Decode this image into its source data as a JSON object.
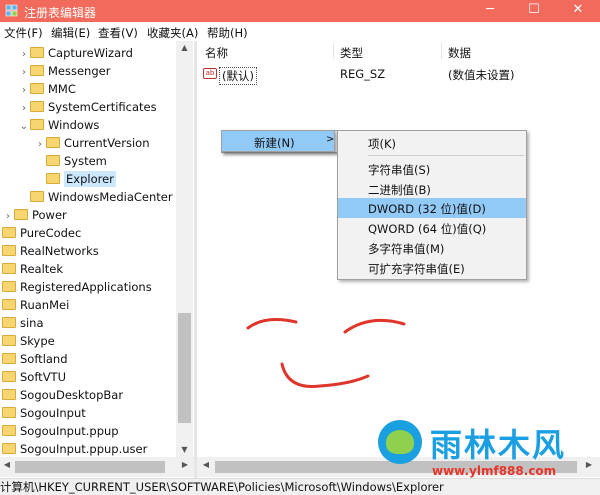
{
  "window": {
    "title": "注册表编辑器",
    "min": "─",
    "max": "☐",
    "close": "✕"
  },
  "menu": [
    "文件(F)",
    "编辑(E)",
    "查看(V)",
    "收藏夹(A)",
    "帮助(H)"
  ],
  "tree": [
    {
      "label": "CaptureWizard",
      "expander": "›"
    },
    {
      "label": "Messenger",
      "expander": "›"
    },
    {
      "label": "MMC",
      "expander": "›"
    },
    {
      "label": "SystemCertificates",
      "expander": "›"
    },
    {
      "label": "Windows",
      "expander": "⌄"
    },
    {
      "label": "CurrentVersion",
      "expander": "›"
    },
    {
      "label": "System",
      "expander": ""
    },
    {
      "label": "Explorer",
      "expander": "",
      "selected": true
    },
    {
      "label": "WindowsMediaCenter",
      "expander": ""
    },
    {
      "label": "Power",
      "expander": "›"
    },
    {
      "label": "PureCodec",
      "expander": ""
    },
    {
      "label": "RealNetworks",
      "expander": ""
    },
    {
      "label": "Realtek",
      "expander": ""
    },
    {
      "label": "RegisteredApplications",
      "expander": ""
    },
    {
      "label": "RuanMei",
      "expander": ""
    },
    {
      "label": "sina",
      "expander": ""
    },
    {
      "label": "Skype",
      "expander": ""
    },
    {
      "label": "Softland",
      "expander": ""
    },
    {
      "label": "SoftVTU",
      "expander": ""
    },
    {
      "label": "SogouDesktopBar",
      "expander": ""
    },
    {
      "label": "SogouInput",
      "expander": ""
    },
    {
      "label": "SogouInput.ppup",
      "expander": ""
    },
    {
      "label": "SogouInput.ppup.user",
      "expander": ""
    }
  ],
  "columns": {
    "name": "名称",
    "type": "类型",
    "data": "数据"
  },
  "values": [
    {
      "icon": "ab",
      "name": "(默认)",
      "type": "REG_SZ",
      "data": "(数值未设置)"
    }
  ],
  "context_menu": {
    "new_label": "新建(N)",
    "new_arrow": ">",
    "submenu": [
      "项(K)",
      "字符串值(S)",
      "二进制值(B)",
      "DWORD (32 位)值(D)",
      "QWORD (64 位)值(Q)",
      "多字符串值(M)",
      "可扩充字符串值(E)"
    ],
    "highlighted": "DWORD (32 位)值(D)"
  },
  "statusbar": {
    "path": "计算机\\HKEY_CURRENT_USER\\SOFTWARE\\Policies\\Microsoft\\Windows\\Explorer"
  },
  "watermark": {
    "brand": "雨林木风",
    "url": "www.ylmf888.com"
  },
  "colors": {
    "titlebar": "#f26a5b",
    "selection": "#cce8ff",
    "menu_highlight": "#91c9f7",
    "doodle": "#e0352b"
  }
}
